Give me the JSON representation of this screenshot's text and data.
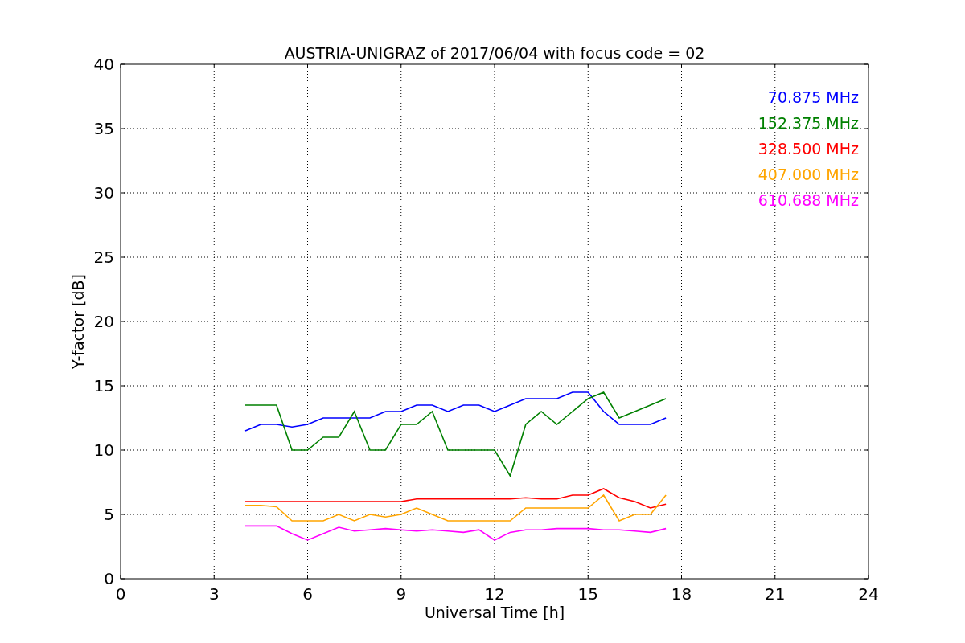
{
  "chart_data": {
    "type": "line",
    "title": "AUSTRIA-UNIGRAZ of 2017/06/04 with focus code = 02",
    "xlabel": "Universal Time [h]",
    "ylabel": "Y-factor [dB]",
    "x": [
      4,
      4.5,
      5,
      5.5,
      6,
      6.5,
      7,
      7.5,
      8,
      8.5,
      9,
      9.5,
      10,
      10.5,
      11,
      11.5,
      12,
      12.5,
      13,
      13.5,
      14,
      14.5,
      15,
      15.5,
      16,
      16.5,
      17,
      17.5
    ],
    "series": [
      {
        "name": "70.875 MHz",
        "color": "#0000ff",
        "values": [
          11.5,
          12,
          12,
          11.8,
          12,
          12.5,
          12.5,
          12.5,
          12.5,
          13,
          13,
          13.5,
          13.5,
          13,
          13.5,
          13.5,
          13,
          13.5,
          14,
          14,
          14,
          14.5,
          14.5,
          13,
          12,
          12,
          12,
          12.5
        ]
      },
      {
        "name": "152.375 MHz",
        "color": "#008000",
        "values": [
          13.5,
          13.5,
          13.5,
          10,
          10,
          11,
          11,
          13,
          10,
          10,
          12,
          12,
          13,
          10,
          10,
          10,
          10,
          8,
          12,
          13,
          12,
          13,
          14,
          14.5,
          12.5,
          13,
          13.5,
          14
        ]
      },
      {
        "name": "328.500 MHz",
        "color": "#ff0000",
        "values": [
          6,
          6,
          6,
          6,
          6,
          6,
          6,
          6,
          6,
          6,
          6,
          6.2,
          6.2,
          6.2,
          6.2,
          6.2,
          6.2,
          6.2,
          6.3,
          6.2,
          6.2,
          6.5,
          6.5,
          7,
          6.3,
          6,
          5.5,
          5.8
        ]
      },
      {
        "name": "407.000 MHz",
        "color": "#ffa500",
        "values": [
          5.7,
          5.7,
          5.6,
          4.5,
          4.5,
          4.5,
          5,
          4.5,
          5,
          4.8,
          5,
          5.5,
          5,
          4.5,
          4.5,
          4.5,
          4.5,
          4.5,
          5.5,
          5.5,
          5.5,
          5.5,
          5.5,
          6.5,
          4.5,
          5,
          5,
          6.5
        ]
      },
      {
        "name": "610.688 MHz",
        "color": "#ff00ff",
        "values": [
          4.1,
          4.1,
          4.1,
          3.5,
          3,
          3.5,
          4,
          3.7,
          3.8,
          3.9,
          3.8,
          3.7,
          3.8,
          3.7,
          3.6,
          3.8,
          3,
          3.6,
          3.8,
          3.8,
          3.9,
          3.9,
          3.9,
          3.8,
          3.8,
          3.7,
          3.6,
          3.9
        ]
      }
    ],
    "xlim": [
      0,
      24
    ],
    "ylim": [
      0,
      40
    ],
    "xticks": [
      0,
      3,
      6,
      9,
      12,
      15,
      18,
      21,
      24
    ],
    "yticks": [
      0,
      5,
      10,
      15,
      20,
      25,
      30,
      35,
      40
    ],
    "grid": true
  }
}
